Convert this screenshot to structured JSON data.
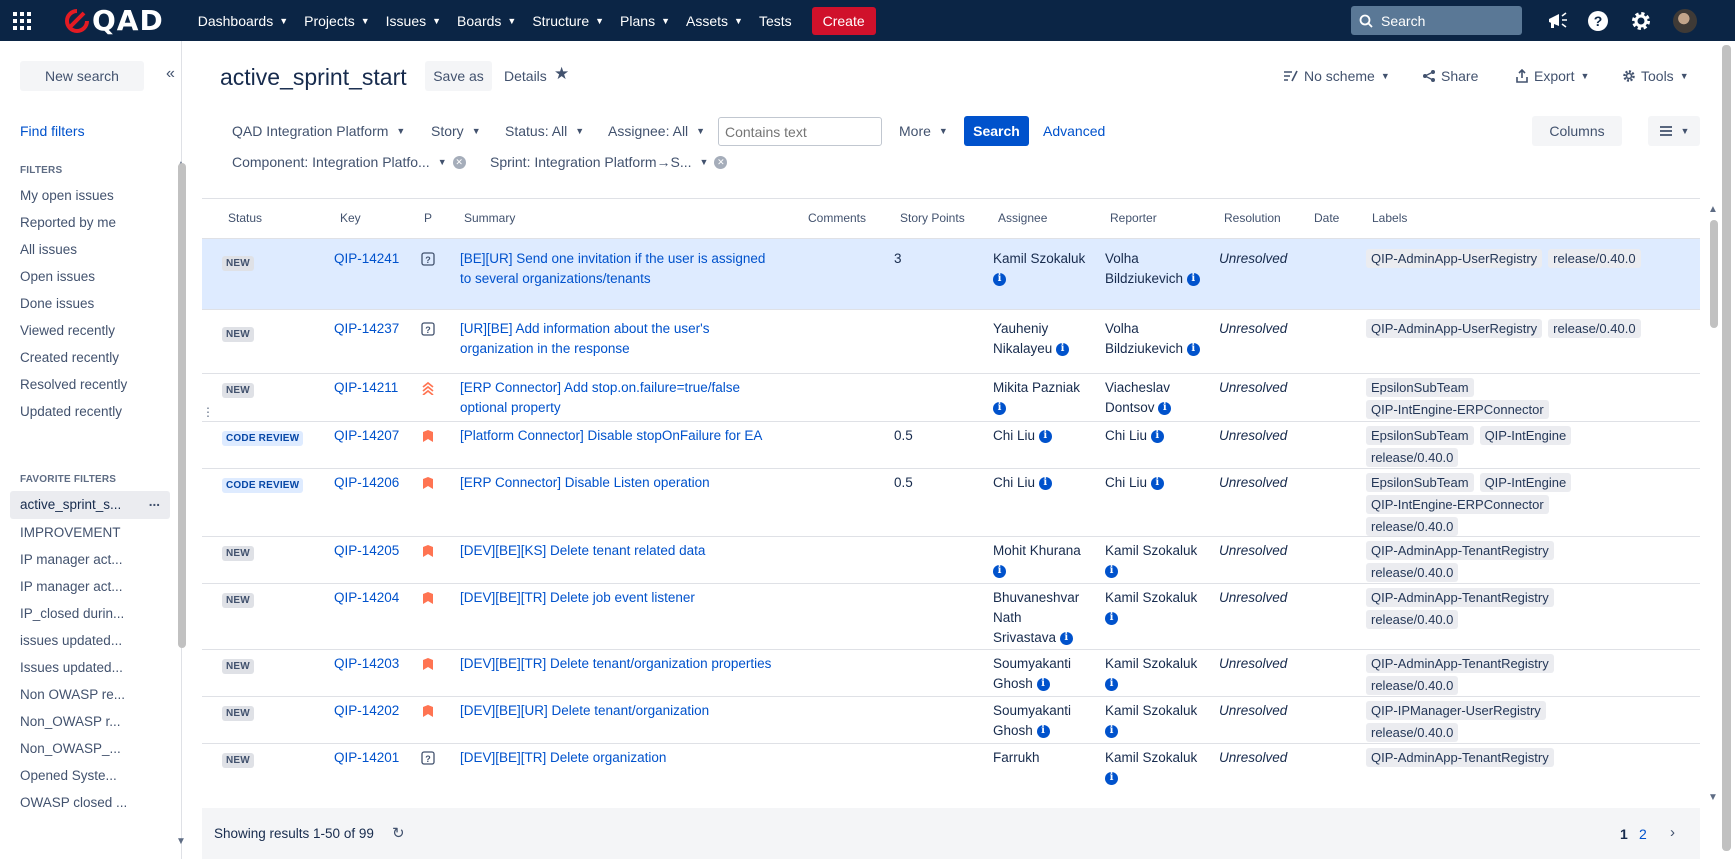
{
  "nav": {
    "logo": "QAD",
    "items": [
      "Dashboards",
      "Projects",
      "Issues",
      "Boards",
      "Structure",
      "Plans",
      "Assets"
    ],
    "tests": "Tests",
    "create": "Create",
    "search_placeholder": "Search",
    "icons": [
      "megaphone-icon",
      "help-icon",
      "settings-icon"
    ]
  },
  "sidebar": {
    "new_search": "New search",
    "find_filters": "Find filters",
    "filters_heading": "FILTERS",
    "filters": [
      "My open issues",
      "Reported by me",
      "All issues",
      "Open issues",
      "Done issues",
      "Viewed recently",
      "Created recently",
      "Resolved recently",
      "Updated recently"
    ],
    "favorites_heading": "FAVORITE FILTERS",
    "favorites": [
      "active_sprint_s...",
      "IMPROVEMENT",
      "IP manager act...",
      "IP manager act...",
      "IP_closed durin...",
      "issues updated...",
      "Issues updated...",
      "Non OWASP re...",
      "Non_OWASP r...",
      "Non_OWASP_...",
      "Opened Syste...",
      "OWASP closed ..."
    ],
    "active_more": "..."
  },
  "header": {
    "title": "active_sprint_start",
    "save_as": "Save as",
    "details": "Details",
    "no_scheme": "No scheme",
    "share": "Share",
    "export": "Export",
    "tools": "Tools"
  },
  "filters": {
    "project": "QAD Integration Platform",
    "type": "Story",
    "status": "Status: All",
    "assignee": "Assignee: All",
    "contains_placeholder": "Contains text",
    "more": "More",
    "search": "Search",
    "advanced": "Advanced",
    "columns": "Columns",
    "component": "Component: Integration Platfo...",
    "sprint": "Sprint: Integration Platform→S..."
  },
  "table": {
    "headers": {
      "status": "Status",
      "key": "Key",
      "p": "P",
      "summary": "Summary",
      "comments": "Comments",
      "story_points": "Story Points",
      "assignee": "Assignee",
      "reporter": "Reporter",
      "resolution": "Resolution",
      "date": "Date",
      "labels": "Labels"
    },
    "rows": [
      {
        "status": "NEW",
        "key": "QIP-14241",
        "priority": "question-icon",
        "summary": "[BE][UR] Send one invitation if the user is assigned to several organizations/tenants",
        "sp": "3",
        "assignee": "Kamil Szokaluk",
        "reporter": "Volha Bildziukevich",
        "resolution": "Unresolved",
        "labels": [
          "QIP-AdminApp-UserRegistry",
          "release/0.40.0"
        ]
      },
      {
        "status": "NEW",
        "key": "QIP-14237",
        "priority": "question-icon",
        "summary": "[UR][BE] Add information about the user's organization in the response",
        "sp": "",
        "assignee": "Yauheniy Nikalayeu",
        "reporter": "Volha Bildziukevich",
        "resolution": "Unresolved",
        "labels": [
          "QIP-AdminApp-UserRegistry",
          "release/0.40.0"
        ]
      },
      {
        "status": "NEW",
        "key": "QIP-14211",
        "priority": "highest-priority-icon",
        "summary": "[ERP Connector] Add stop.on.failure=true/false optional property",
        "sp": "",
        "assignee": "Mikita Pazniak",
        "reporter": "Viacheslav Dontsov",
        "resolution": "Unresolved",
        "labels": [
          "EpsilonSubTeam",
          "QIP-IntEngine-ERPConnector"
        ]
      },
      {
        "status": "CODE REVIEW",
        "key": "QIP-14207",
        "priority": "high-priority-icon",
        "summary": "[Platform Connector] Disable stopOnFailure for EA",
        "sp": "0.5",
        "assignee": "Chi Liu",
        "reporter": "Chi Liu",
        "resolution": "Unresolved",
        "labels": [
          "EpsilonSubTeam",
          "QIP-IntEngine",
          "release/0.40.0"
        ]
      },
      {
        "status": "CODE REVIEW",
        "key": "QIP-14206",
        "priority": "high-priority-icon",
        "summary": "[ERP Connector] Disable Listen operation",
        "sp": "0.5",
        "assignee": "Chi Liu",
        "reporter": "Chi Liu",
        "resolution": "Unresolved",
        "labels": [
          "EpsilonSubTeam",
          "QIP-IntEngine",
          "QIP-IntEngine-ERPConnector",
          "release/0.40.0"
        ]
      },
      {
        "status": "NEW",
        "key": "QIP-14205",
        "priority": "high-priority-icon",
        "summary": "[DEV][BE][KS] Delete tenant related data",
        "sp": "",
        "assignee": "Mohit Khurana",
        "reporter": "Kamil Szokaluk",
        "resolution": "Unresolved",
        "labels": [
          "QIP-AdminApp-TenantRegistry",
          "release/0.40.0"
        ]
      },
      {
        "status": "NEW",
        "key": "QIP-14204",
        "priority": "high-priority-icon",
        "summary": "[DEV][BE][TR] Delete job event listener",
        "sp": "",
        "assignee": "Bhuvaneshvar Nath Srivastava",
        "reporter": "Kamil Szokaluk",
        "resolution": "Unresolved",
        "labels": [
          "QIP-AdminApp-TenantRegistry",
          "release/0.40.0"
        ]
      },
      {
        "status": "NEW",
        "key": "QIP-14203",
        "priority": "high-priority-icon",
        "summary": "[DEV][BE][TR] Delete tenant/organization properties",
        "sp": "",
        "assignee": "Soumyakanti Ghosh",
        "reporter": "Kamil Szokaluk",
        "resolution": "Unresolved",
        "labels": [
          "QIP-AdminApp-TenantRegistry",
          "release/0.40.0"
        ]
      },
      {
        "status": "NEW",
        "key": "QIP-14202",
        "priority": "high-priority-icon",
        "summary": "[DEV][BE][UR] Delete tenant/organization",
        "sp": "",
        "assignee": "Soumyakanti Ghosh",
        "reporter": "Kamil Szokaluk",
        "resolution": "Unresolved",
        "labels": [
          "QIP-IPManager-UserRegistry",
          "release/0.40.0"
        ]
      },
      {
        "status": "NEW",
        "key": "QIP-14201",
        "priority": "question-icon",
        "summary": "[DEV][BE][TR] Delete organization",
        "sp": "",
        "assignee": "Farrukh",
        "reporter": "Kamil Szokaluk",
        "resolution": "Unresolved",
        "labels": [
          "QIP-AdminApp-TenantRegistry"
        ]
      }
    ]
  },
  "footer": {
    "showing": "Showing results 1-50 of 99",
    "pages": [
      "1",
      "2"
    ]
  },
  "colors": {
    "nav_bg": "#0b2545",
    "create": "#d0112b",
    "primary": "#0052cc",
    "selected_row": "#deebff",
    "priority_high": "#ff7452"
  }
}
